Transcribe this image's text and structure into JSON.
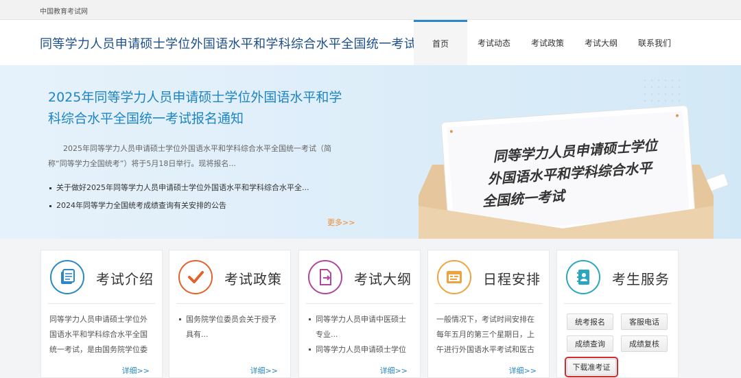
{
  "topbar": {
    "site_name": "中国教育考试网"
  },
  "header": {
    "title": "同等学力人员申请硕士学位外国语水平和学科综合水平全国统一考试",
    "nav": [
      {
        "label": "首页",
        "active": true
      },
      {
        "label": "考试动态",
        "active": false
      },
      {
        "label": "考试政策",
        "active": false
      },
      {
        "label": "考试大纲",
        "active": false
      },
      {
        "label": "联系我们",
        "active": false
      }
    ]
  },
  "banner": {
    "headline": "2025年同等学力人员申请硕士学位外国语水平和学科综合水平全国统一考试报名通知",
    "summary": "2025年同等学力人员申请硕士学位外国语水平和学科综合水平全国统一考试（简称“同等学力全国统考”）将于5月18日举行。现将报名...",
    "links": [
      "关于做好2025年同等学力人员申请硕士学位外国语水平和学科综合水平全...",
      "2024年同等学力全国统考成绩查询有关安排的公告"
    ],
    "more": "更多>>",
    "art_text": [
      "同等学力人员申请硕士学位",
      "外国语水平和学科综合水平",
      "全国统一考试"
    ]
  },
  "cards": {
    "intro": {
      "title": "考试介绍",
      "text": "同等学力人员申请硕士学位外国语水平和学科综合水平全国统一考试，是由国务院学位委",
      "detail": "详细>>"
    },
    "policy": {
      "title": "考试政策",
      "items": [
        "国务院学位委员会关于授予具有..."
      ],
      "detail": "详细>>"
    },
    "syllabus": {
      "title": "考试大纲",
      "items": [
        "同等学力人员申请中医硕士专业...",
        "同等学力人员申请硕士学位"
      ],
      "detail": "详细>>"
    },
    "schedule": {
      "title": "日程安排",
      "text": "一般情况下，考试时间安排在每年五月的第三个星期日，上午进行外国语水平考试和医古",
      "detail": "详细>>"
    },
    "service": {
      "title": "考生服务",
      "buttons": [
        "统考报名",
        "客服电话",
        "成绩查询",
        "成绩复核",
        "下载准考证"
      ]
    }
  },
  "colors": {
    "brand_blue": "#1e84c4",
    "title_blue": "#1c4f8c",
    "accent_orange": "#f08b2c",
    "highlight_red": "#d6282c"
  }
}
